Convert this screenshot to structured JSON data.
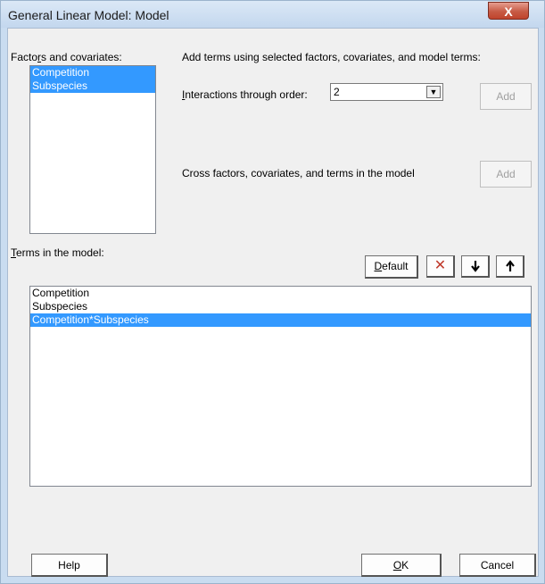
{
  "window": {
    "title": "General Linear Model: Model",
    "close_label": "X"
  },
  "factors": {
    "label_pre": "Facto",
    "label_u": "r",
    "label_post": "s and covariates:",
    "items": [
      "Competition",
      "Subspecies"
    ]
  },
  "add_terms": {
    "instruction": "Add terms using selected factors, covariates, and model terms:",
    "interactions_label_u": "I",
    "interactions_label_post": "nteractions through order:",
    "order_value": "2",
    "add_label": "Add",
    "cross_label": "Cross factors, covariates, and terms in the model",
    "add2_label": "Add"
  },
  "terms": {
    "label_u": "T",
    "label_post": "erms in the model:",
    "items": [
      "Competition",
      "Subspecies",
      "Competition*Subspecies"
    ],
    "selected_index": 2
  },
  "toolbar": {
    "default_u": "D",
    "default_post": "efault",
    "delete_glyph": "✕",
    "down_glyph": "🡓",
    "up_glyph": "🡑"
  },
  "footer": {
    "help_label": "Help",
    "ok_u": "O",
    "ok_post": "K",
    "cancel_label": "Cancel"
  },
  "colors": {
    "selection": "#3399ff",
    "delete_red": "#c0392b"
  }
}
